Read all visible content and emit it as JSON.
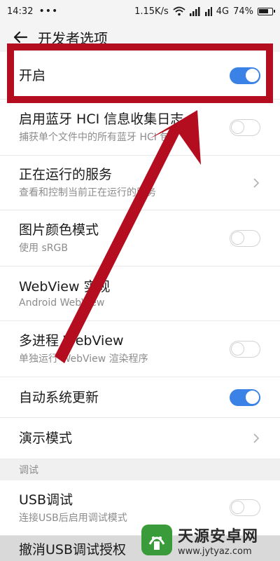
{
  "status_bar": {
    "time": "14:32",
    "dots": "•••",
    "speed": "1.15K/s",
    "network": "4G",
    "battery": "74%",
    "battery_level": 0.74
  },
  "header": {
    "title": "开发者选项",
    "back_icon": "back-arrow-icon"
  },
  "rows": [
    {
      "title": "开启",
      "toggle": true
    },
    {
      "title": "启用蓝牙 HCI 信息收集日志",
      "subtitle": "捕获单个文件中的所有蓝牙 HCI 包",
      "toggle": false
    },
    {
      "title": "正在运行的服务",
      "subtitle": "查看和控制当前正在运行的服务",
      "chevron": true
    },
    {
      "title": "图片颜色模式",
      "subtitle": "使用 sRGB",
      "toggle": false
    },
    {
      "title": "WebView 实现",
      "subtitle": "Android WebView"
    },
    {
      "title": "多进程 WebView",
      "subtitle": "单独运行 WebView 渲染程序",
      "toggle": false
    },
    {
      "title": "自动系统更新",
      "toggle": true
    },
    {
      "title": "演示模式",
      "chevron": true
    },
    {
      "title": "USB调试",
      "subtitle": "连接USB后启用调试模式",
      "toggle": false
    }
  ],
  "section": {
    "debug_label": "调试"
  },
  "bottom_item": "撤消USB调试授权",
  "watermark": {
    "title": "天源安卓网",
    "url": "www.jytyaz.com"
  },
  "colors": {
    "accent": "#3b82e6",
    "annotation": "#b40d1f"
  }
}
